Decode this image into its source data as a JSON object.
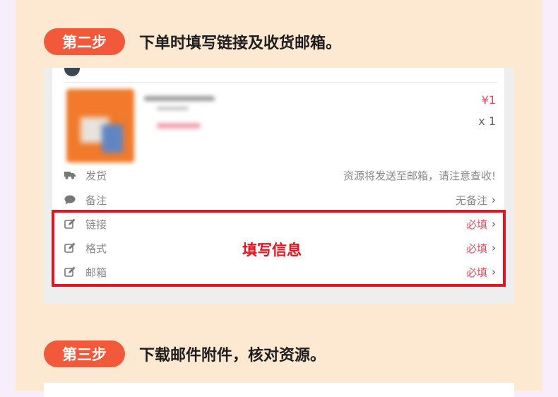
{
  "step2": {
    "badge": "第二步",
    "text": "下单时填写链接及收货邮箱。"
  },
  "order": {
    "price": "¥1",
    "qty": "x 1"
  },
  "rows": [
    {
      "label": "发货",
      "value": "资源将发送至邮箱，请注意查收!",
      "icon": "truck-icon"
    },
    {
      "label": "备注",
      "value": "无备注",
      "icon": "speech-bubble-icon"
    },
    {
      "label": "链接",
      "value": "必填",
      "icon": "edit-icon"
    },
    {
      "label": "格式",
      "value": "必填",
      "icon": "edit-icon"
    },
    {
      "label": "邮箱",
      "value": "必填",
      "icon": "edit-icon"
    }
  ],
  "annotation": "填写信息",
  "step3": {
    "badge": "第三步",
    "text": "下载邮件附件，核对资源。"
  },
  "colors": {
    "accent": "#f2593a",
    "required": "#e84a5f",
    "highlight": "#e8131c",
    "panel": "#fde8d2"
  }
}
